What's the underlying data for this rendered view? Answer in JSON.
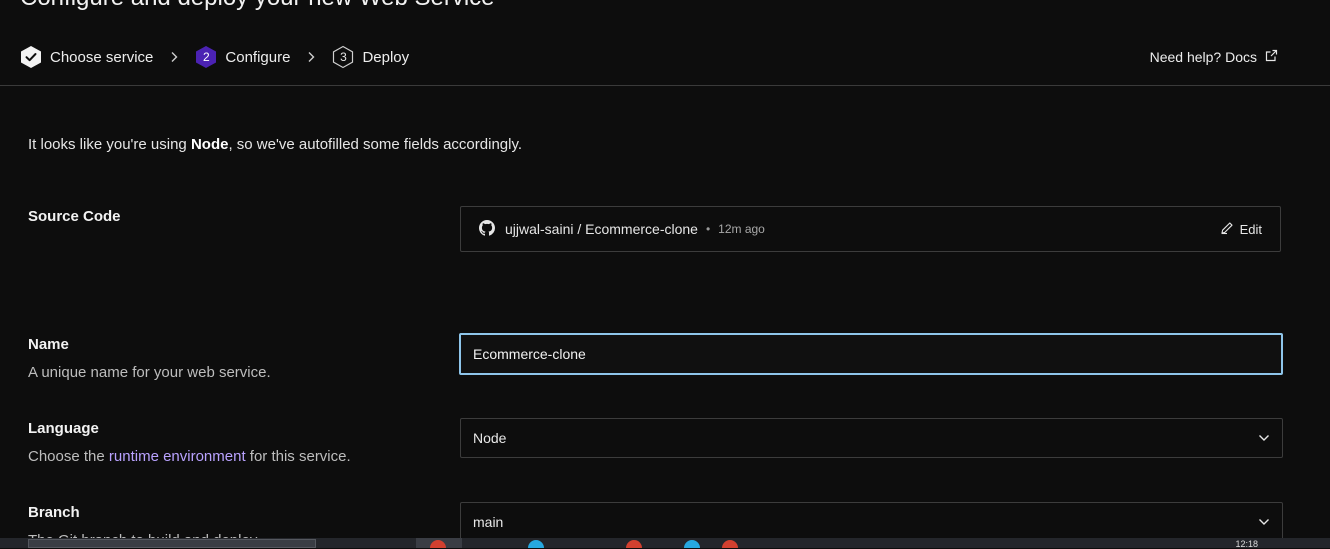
{
  "page": {
    "title": "Configure and deploy your new Web Service"
  },
  "stepper": {
    "steps": [
      {
        "label": "Choose service",
        "badge": "",
        "state": "done"
      },
      {
        "label": "Configure",
        "badge": "2",
        "state": "active"
      },
      {
        "label": "Deploy",
        "badge": "3",
        "state": "pending"
      }
    ]
  },
  "help": {
    "label": "Need help? Docs",
    "icon": "external-link-icon"
  },
  "notice": {
    "prefix": "It looks like you're using ",
    "language": "Node",
    "suffix": ", so we've autofilled some fields accordingly."
  },
  "source": {
    "label": "Source Code",
    "repo": "ujjwal-saini / Ecommerce-clone",
    "separator": "•",
    "age": "12m ago",
    "edit_label": "Edit",
    "icon": "github-icon"
  },
  "name": {
    "label": "Name",
    "description": "A unique name for your web service.",
    "value": "Ecommerce-clone"
  },
  "language": {
    "label": "Language",
    "description_prefix": "Choose the ",
    "description_link": "runtime environment",
    "description_suffix": " for this service.",
    "value": "Node"
  },
  "branch": {
    "label": "Branch",
    "description": "The Git branch to build and deploy.",
    "value": "main"
  },
  "taskbar": {
    "clock": "12:18"
  },
  "colors": {
    "background": "#0d0d0d",
    "accent": "#4b22b3",
    "link": "#b9a2ff",
    "focus_border": "#8ec5ea"
  }
}
